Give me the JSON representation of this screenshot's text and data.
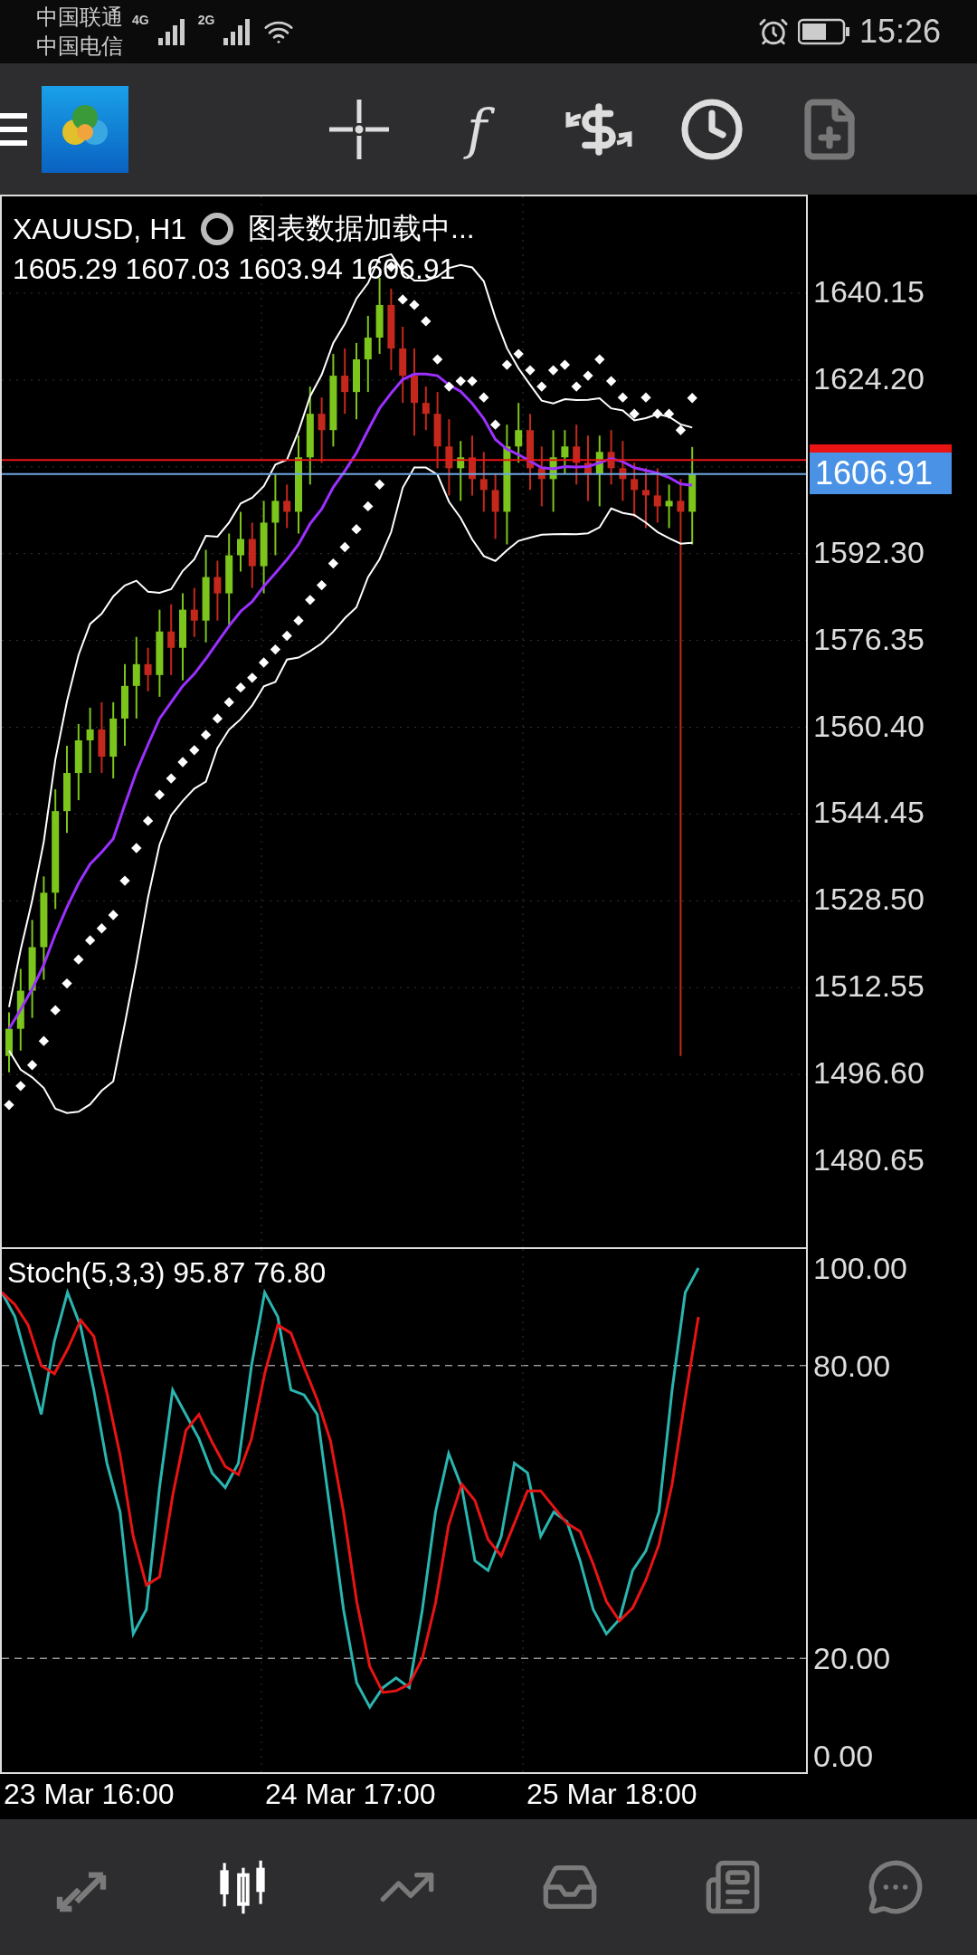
{
  "status_bar": {
    "carriers": [
      "中国联通",
      "中国电信"
    ],
    "network_types": [
      "4G",
      "2G"
    ],
    "time": "15:26"
  },
  "toolbar": {
    "indicator_glyph": "f"
  },
  "chart": {
    "symbol": "XAUUSD, H1",
    "loading_text": "图表数据加载中...",
    "ohlc": "1605.29 1607.03 1603.94 1606.91",
    "current_price": "1606.91",
    "price_axis": [
      "1640.15",
      "1624.20",
      "1592.30",
      "1576.35",
      "1560.40",
      "1544.45",
      "1528.50",
      "1512.55",
      "1496.60",
      "1480.65"
    ]
  },
  "indicator": {
    "label": "Stoch(5,3,3) 95.87 76.80",
    "axis": [
      "100.00",
      "80.00",
      "20.00",
      "0.00"
    ]
  },
  "time_axis": [
    "23 Mar 16:00",
    "24 Mar 17:00",
    "25 Mar 18:00"
  ],
  "bottom_nav": [
    {
      "kind": "quotes",
      "selected": false
    },
    {
      "kind": "chart",
      "selected": true
    },
    {
      "kind": "trade",
      "selected": false
    },
    {
      "kind": "history",
      "selected": false
    },
    {
      "kind": "news",
      "selected": false
    },
    {
      "kind": "chat",
      "selected": false
    }
  ]
}
